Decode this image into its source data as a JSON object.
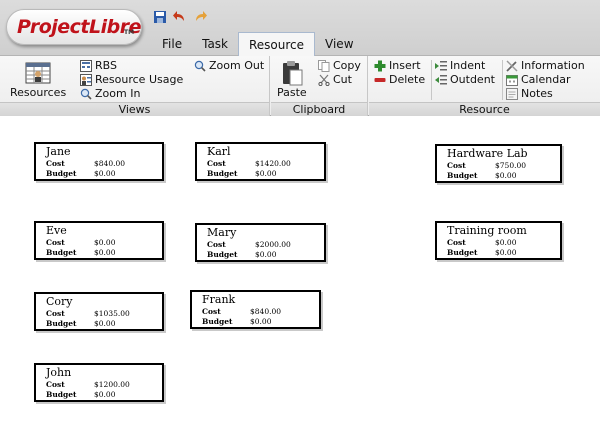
{
  "app": {
    "logo_text": "ProjectLibre",
    "logo_tm": "TM"
  },
  "quick_access": [
    {
      "name": "save-icon"
    },
    {
      "name": "undo-icon"
    },
    {
      "name": "redo-icon"
    }
  ],
  "tabs": [
    {
      "label": "File",
      "active": false
    },
    {
      "label": "Task",
      "active": false
    },
    {
      "label": "Resource",
      "active": true
    },
    {
      "label": "View",
      "active": false
    }
  ],
  "ribbon": {
    "views": {
      "label": "Views",
      "resources_label": "Resources",
      "rbs_label": "RBS",
      "resource_usage_label": "Resource Usage",
      "zoom_in_label": "Zoom In",
      "zoom_out_label": "Zoom Out"
    },
    "clipboard": {
      "label": "Clipboard",
      "paste_label": "Paste",
      "copy_label": "Copy",
      "cut_label": "Cut"
    },
    "resource": {
      "label": "Resource",
      "insert_label": "Insert",
      "delete_label": "Delete",
      "indent_label": "Indent",
      "outdent_label": "Outdent",
      "information_label": "Information",
      "calendar_label": "Calendar",
      "notes_label": "Notes"
    }
  },
  "field_labels": {
    "cost": "Cost",
    "budget": "Budget"
  },
  "nodes": [
    {
      "name": "Jane",
      "cost": "$840.00",
      "budget": "$0.00"
    },
    {
      "name": "Karl",
      "cost": "$1420.00",
      "budget": "$0.00"
    },
    {
      "name": "Hardware Lab",
      "cost": "$750.00",
      "budget": "$0.00"
    },
    {
      "name": "Eve",
      "cost": "$0.00",
      "budget": "$0.00"
    },
    {
      "name": "Mary",
      "cost": "$2000.00",
      "budget": "$0.00"
    },
    {
      "name": "Training room",
      "cost": "$0.00",
      "budget": "$0.00"
    },
    {
      "name": "Cory",
      "cost": "$1035.00",
      "budget": "$0.00"
    },
    {
      "name": "Frank",
      "cost": "$840.00",
      "budget": "$0.00"
    },
    {
      "name": "John",
      "cost": "$1200.00",
      "budget": "$0.00"
    }
  ],
  "colors": {
    "brand_red": "#c0121a",
    "insert_green": "#2e8b2e",
    "delete_red": "#c62828",
    "active_tab_border": "#a9b9cf"
  }
}
